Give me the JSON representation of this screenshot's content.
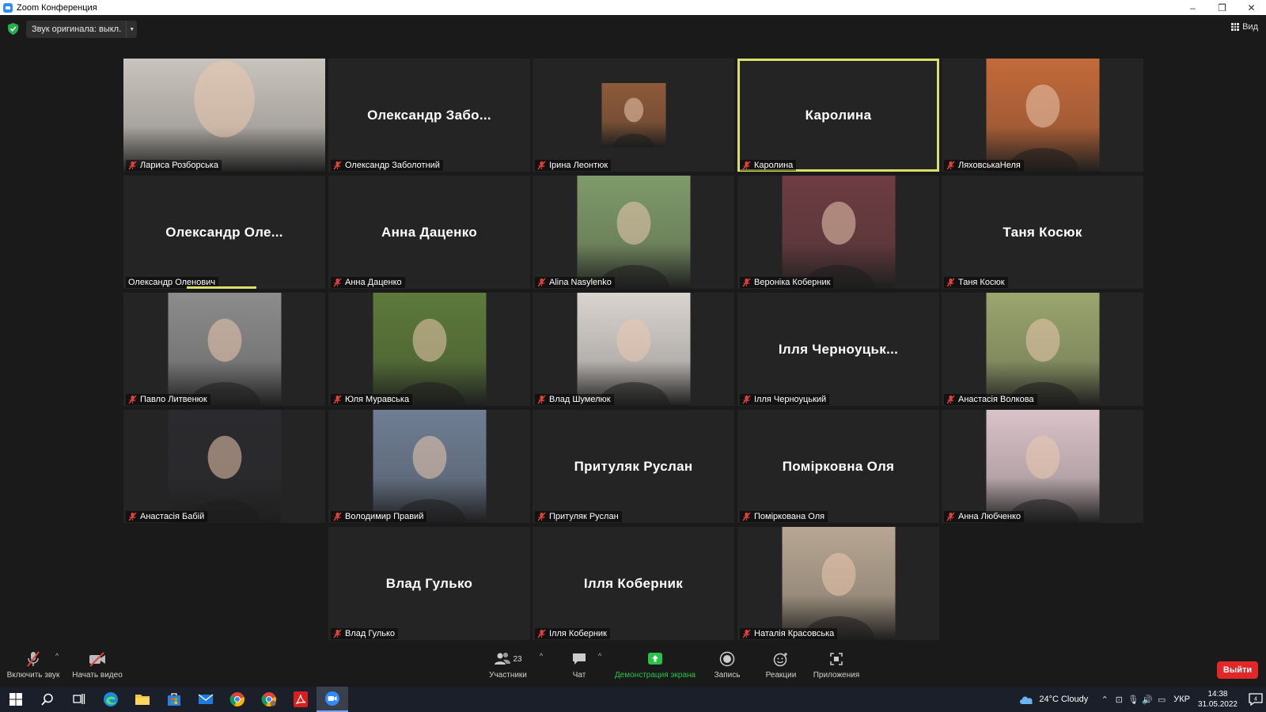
{
  "window": {
    "title": "Zoom Конференция",
    "controls": [
      "–",
      "❐",
      "✕"
    ]
  },
  "topbar": {
    "audio_original": "Звук оригинала: выкл.",
    "view_label": "Вид"
  },
  "tiles": [
    {
      "display": "Лариса Розборська",
      "label": "Лариса Розборська",
      "muted": true,
      "kind": "photo-wide",
      "bg": "#c9c4bd"
    },
    {
      "display": "Олександр  Забо...",
      "label": "Олександр Заболотний",
      "muted": true,
      "kind": "name"
    },
    {
      "display": "Ірина Леонтюк",
      "label": "Ірина Леонтюк",
      "muted": true,
      "kind": "photo-small",
      "bg": "#8e5a3a"
    },
    {
      "display": "Каролина",
      "label": "Каролина",
      "muted": true,
      "kind": "name",
      "active": true
    },
    {
      "display": "ЛяховськаНеля",
      "label": "ЛяховськаНеля",
      "muted": true,
      "kind": "photo",
      "bg": "#c36a3a"
    },
    {
      "display": "Олександр  Оле...",
      "label": "Олександр Оленович",
      "muted": false,
      "kind": "name",
      "speaking": true
    },
    {
      "display": "Анна Даценко",
      "label": "Анна Даценко",
      "muted": true,
      "kind": "name"
    },
    {
      "display": "Alina Nasylenko",
      "label": "Alina Nasylenko",
      "muted": true,
      "kind": "photo",
      "bg": "#7f9a6a"
    },
    {
      "display": "Вероніка Коберник",
      "label": "Вероніка Коберник",
      "muted": true,
      "kind": "photo",
      "bg": "#6d3d42"
    },
    {
      "display": "Таня Косюк",
      "label": "Таня Косюк",
      "muted": true,
      "kind": "name"
    },
    {
      "display": "Павло Литвенюк",
      "label": "Павло Литвенюк",
      "muted": true,
      "kind": "photo",
      "bg": "#8c8c8c"
    },
    {
      "display": "Юля Муравська",
      "label": "Юля Муравська",
      "muted": true,
      "kind": "photo",
      "bg": "#5d7a3a"
    },
    {
      "display": "Влад Шумелюк",
      "label": "Влад Шумелюк",
      "muted": true,
      "kind": "photo",
      "bg": "#d9d4d0"
    },
    {
      "display": "Ілля  Черноуцьк...",
      "label": "Ілля Черноуцький",
      "muted": true,
      "kind": "name"
    },
    {
      "display": "Анастасія Волкова",
      "label": "Анастасія Волкова",
      "muted": true,
      "kind": "photo",
      "bg": "#9aa56e"
    },
    {
      "display": "Анастасія  Бабій",
      "label": "Анастасія  Бабій",
      "muted": true,
      "kind": "photo",
      "bg": "#2b2a2e"
    },
    {
      "display": "Володимир Правий",
      "label": "Володимир Правий",
      "muted": true,
      "kind": "photo",
      "bg": "#6f7e93"
    },
    {
      "display": "Притуляк Руслан",
      "label": "Притуляк Руслан",
      "muted": true,
      "kind": "name"
    },
    {
      "display": "Помірковна Оля",
      "label": "Поміркована Оля",
      "muted": true,
      "kind": "name"
    },
    {
      "display": "Анна Любченко",
      "label": "Анна Любченко",
      "muted": true,
      "kind": "photo",
      "bg": "#d9c3c8"
    },
    {
      "display": "Влад Гулько",
      "label": "Влад Гулько",
      "muted": true,
      "kind": "name"
    },
    {
      "display": "Ілля Коберник",
      "label": "Ілля Коберник",
      "muted": true,
      "kind": "name"
    },
    {
      "display": "Наталія Красовська",
      "label": "Наталія Красовська",
      "muted": true,
      "kind": "photo",
      "bg": "#b7a692"
    }
  ],
  "toolbar": {
    "unmute": "Включить звук",
    "start_video": "Начать видео",
    "participants": "Участники",
    "participants_count": "23",
    "chat": "Чат",
    "share": "Демонстрация экрана",
    "record": "Запись",
    "reactions": "Реакции",
    "apps": "Приложения",
    "leave": "Выйти"
  },
  "taskbar": {
    "weather": "24°C  Cloudy",
    "language": "УКР",
    "time": "14:38",
    "date": "31.05.2022",
    "notifications_count": "4"
  },
  "colors": {
    "active_border": "#d8e06a",
    "share_green": "#26c24a",
    "leave_red": "#e02828",
    "mute_red": "#e0423a"
  }
}
